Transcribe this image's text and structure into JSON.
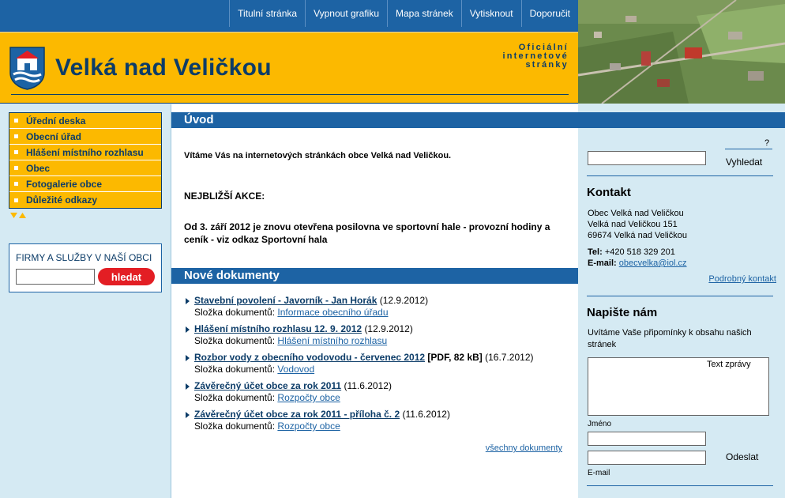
{
  "nav": {
    "items": [
      "Titulní stránka",
      "Vypnout grafiku",
      "Mapa stránek",
      "Vytisknout",
      "Doporučit"
    ]
  },
  "header": {
    "title": "Velká nad Veličkou",
    "tagline_1": "Oficiální",
    "tagline_2": "internetové",
    "tagline_3": "stránky"
  },
  "sidebar": {
    "menu": [
      "Úřední deska",
      "Obecní úřad",
      "Hlášení místního rozhlasu",
      "Obec",
      "Fotogalerie obce",
      "Důležité odkazy"
    ],
    "firmy_title": "FIRMY A SLUŽBY V NAŠÍ OBCI",
    "firmy_button": "hledat"
  },
  "main": {
    "uvod_title": "Úvod",
    "welcome": "Vítáme Vás na internetových stránkách obce Velká nad Veličkou.",
    "events_heading": "NEJBLIŽŠÍ AKCE:",
    "event_text": "Od 3. září 2012 je znovu otevřena posilovna ve sportovní hale - provozní hodiny a ceník - viz odkaz Sportovní hala",
    "docs_title": "Nové dokumenty",
    "folder_label": "Složka dokumentů:",
    "documents": [
      {
        "title": "Stavební povolení - Javorník - Jan Horák",
        "extra": "",
        "date": "(12.9.2012)",
        "folder": "Informace obecního úřadu"
      },
      {
        "title": "Hlášení místního rozhlasu 12. 9. 2012",
        "extra": "",
        "date": "(12.9.2012)",
        "folder": "Hlášení místního rozhlasu"
      },
      {
        "title": "Rozbor vody z obecního vodovodu - červenec 2012",
        "extra": "[PDF, 82 kB]",
        "date": "(16.7.2012)",
        "folder": "Vodovod"
      },
      {
        "title": "Závěrečný účet obce za rok 2011",
        "extra": "",
        "date": "(11.6.2012)",
        "folder": "Rozpočty obce"
      },
      {
        "title": "Závěrečný účet obce za rok 2011 - příloha č. 2",
        "extra": "",
        "date": "(11.6.2012)",
        "folder": "Rozpočty obce"
      }
    ],
    "all_docs": "všechny dokumenty"
  },
  "right": {
    "help": "?",
    "search_button": "Vyhledat",
    "contact_title": "Kontakt",
    "address_1": "Obec Velká nad Veličkou",
    "address_2": "Velká nad Veličkou 151",
    "address_3": "69674 Velká nad Veličkou",
    "tel_label": "Tel:",
    "tel_value": "+420 518 329 201",
    "email_label": "E-mail:",
    "email_value": "obecvelka@iol.cz",
    "detail_link": "Podrobný kontakt",
    "write_title": "Napište nám",
    "write_text": "Uvítáme Vaše připomínky k obsahu našich stránek",
    "message_label": "Text zprávy",
    "name_label": "Jméno",
    "email_field_label": "E-mail",
    "send_button": "Odeslat"
  },
  "colors": {
    "primary_blue": "#1d63a4",
    "header_yellow": "#fcb900",
    "title_navy": "#0c3c68",
    "light_bg": "#d5eaf3",
    "button_red": "#e31e24"
  }
}
